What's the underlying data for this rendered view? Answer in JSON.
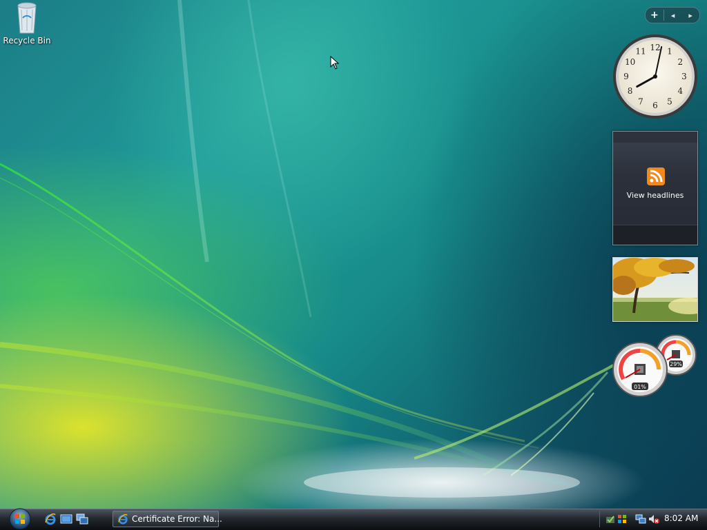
{
  "desktop": {
    "icons": [
      {
        "label": "Recycle Bin",
        "icon": "recycle-bin-icon"
      }
    ]
  },
  "sidebar": {
    "controls": {
      "add": "+",
      "prev": "◂",
      "next": "▸"
    },
    "clock": {
      "numerals": [
        "12",
        "1",
        "2",
        "3",
        "4",
        "5",
        "6",
        "7",
        "8",
        "9",
        "10",
        "11"
      ],
      "time_hour": 8,
      "time_minute": 2
    },
    "feed": {
      "label": "View headlines",
      "icon": "rss-feed-icon"
    },
    "slideshow": {
      "description_icon": "autumn-tree-photo"
    },
    "meters": {
      "cpu_percent": "01%",
      "memory_percent": "29%",
      "cpu_value": 1,
      "memory_value": 29
    }
  },
  "taskbar": {
    "start_icon": "windows-orb-icon",
    "quick_launch": [
      {
        "icon": "internet-explorer-icon"
      },
      {
        "icon": "show-desktop-icon"
      },
      {
        "icon": "switch-windows-icon"
      }
    ],
    "tasks": [
      {
        "label": "Certificate Error: Na...",
        "icon": "internet-explorer-icon"
      }
    ],
    "tray": {
      "icons": [
        "windows-defender-icon",
        "windows-update-icon",
        "network-icon",
        "volume-muted-icon"
      ],
      "time": "8:02 AM"
    }
  },
  "colors": {
    "taskbar": "#1a1e23",
    "accent_orange": "#f08a1e"
  }
}
